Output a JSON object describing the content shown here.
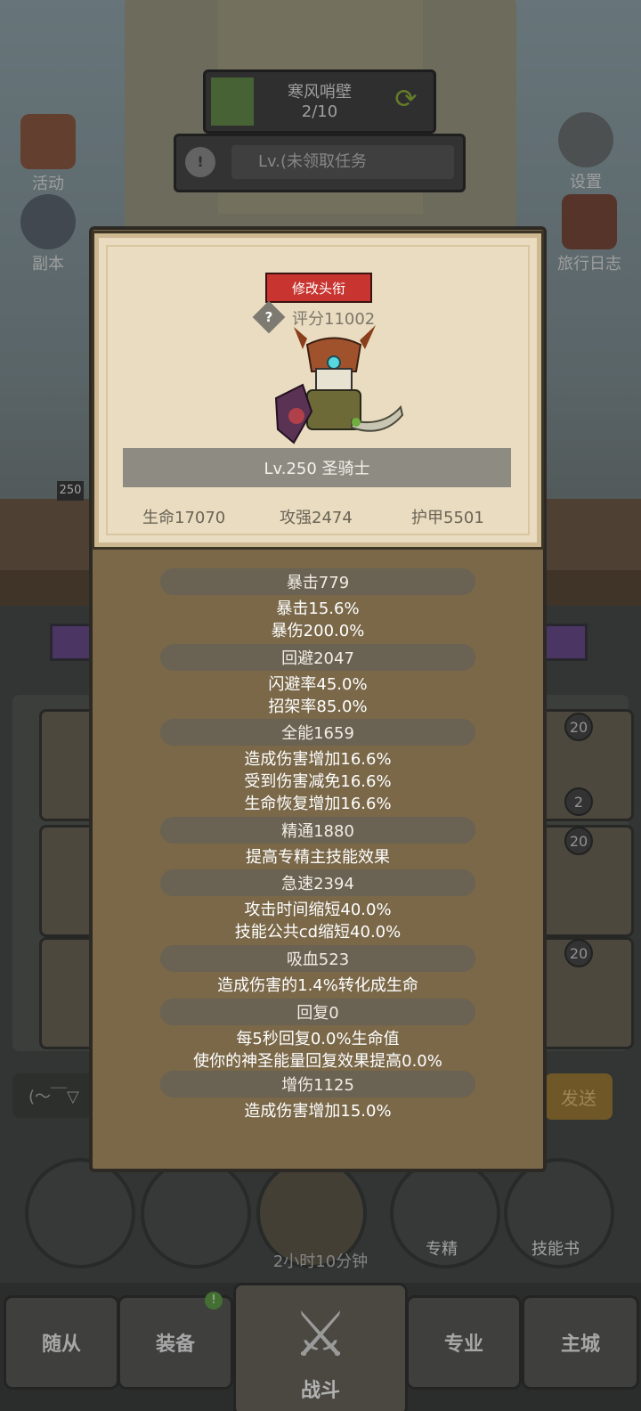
{
  "background": {
    "top_progress": {
      "title": "寒风哨壁",
      "count": "2/10"
    },
    "task_bar": {
      "text": "Lv.(未领取任务"
    },
    "left_icons": [
      {
        "label": "活动"
      },
      {
        "label": "副本"
      }
    ],
    "right_icons": [
      {
        "label": "设置"
      },
      {
        "label": "旅行日志"
      }
    ],
    "level_tag": "250",
    "slot_badges": [
      "20",
      "2",
      "20",
      "20"
    ],
    "chat_text": "(～￣▽",
    "send_label": "发送",
    "circles": [
      {
        "label": ""
      },
      {
        "label": ""
      },
      {
        "label": ""
      },
      {
        "label": "专精"
      },
      {
        "label": "技能书"
      }
    ],
    "timer": "2小时10分钟",
    "nav": {
      "follower": "随从",
      "equipment": "装备",
      "battle": "战斗",
      "profession": "专业",
      "city": "主城"
    },
    "notify": "!"
  },
  "modal": {
    "title_button": "修改头衔",
    "help_icon": "?",
    "score": "评分11002",
    "hero_name": "Lv.250 圣骑士",
    "core": {
      "hp": "生命17070",
      "attack": "攻强2474",
      "armor": "护甲5501"
    },
    "sections": [
      {
        "header": "暴击779",
        "lines": [
          "暴击15.6%",
          "暴伤200.0%"
        ]
      },
      {
        "header": "回避2047",
        "lines": [
          "闪避率45.0%",
          "招架率85.0%"
        ]
      },
      {
        "header": "全能1659",
        "lines": [
          "造成伤害增加16.6%",
          "受到伤害减免16.6%",
          "生命恢复增加16.6%"
        ]
      },
      {
        "header": "精通1880",
        "lines": [
          "提高专精主技能效果"
        ]
      },
      {
        "header": "急速2394",
        "lines": [
          "攻击时间缩短40.0%",
          "技能公共cd缩短40.0%"
        ]
      },
      {
        "header": "吸血523",
        "lines": [
          "造成伤害的1.4%转化成生命"
        ]
      },
      {
        "header": "回复0",
        "lines": [
          "每5秒回复0.0%生命值",
          "使你的神圣能量回复效果提高0.0%"
        ]
      },
      {
        "header": "增伤1125",
        "lines": [
          "造成伤害增加15.0%"
        ]
      }
    ]
  }
}
